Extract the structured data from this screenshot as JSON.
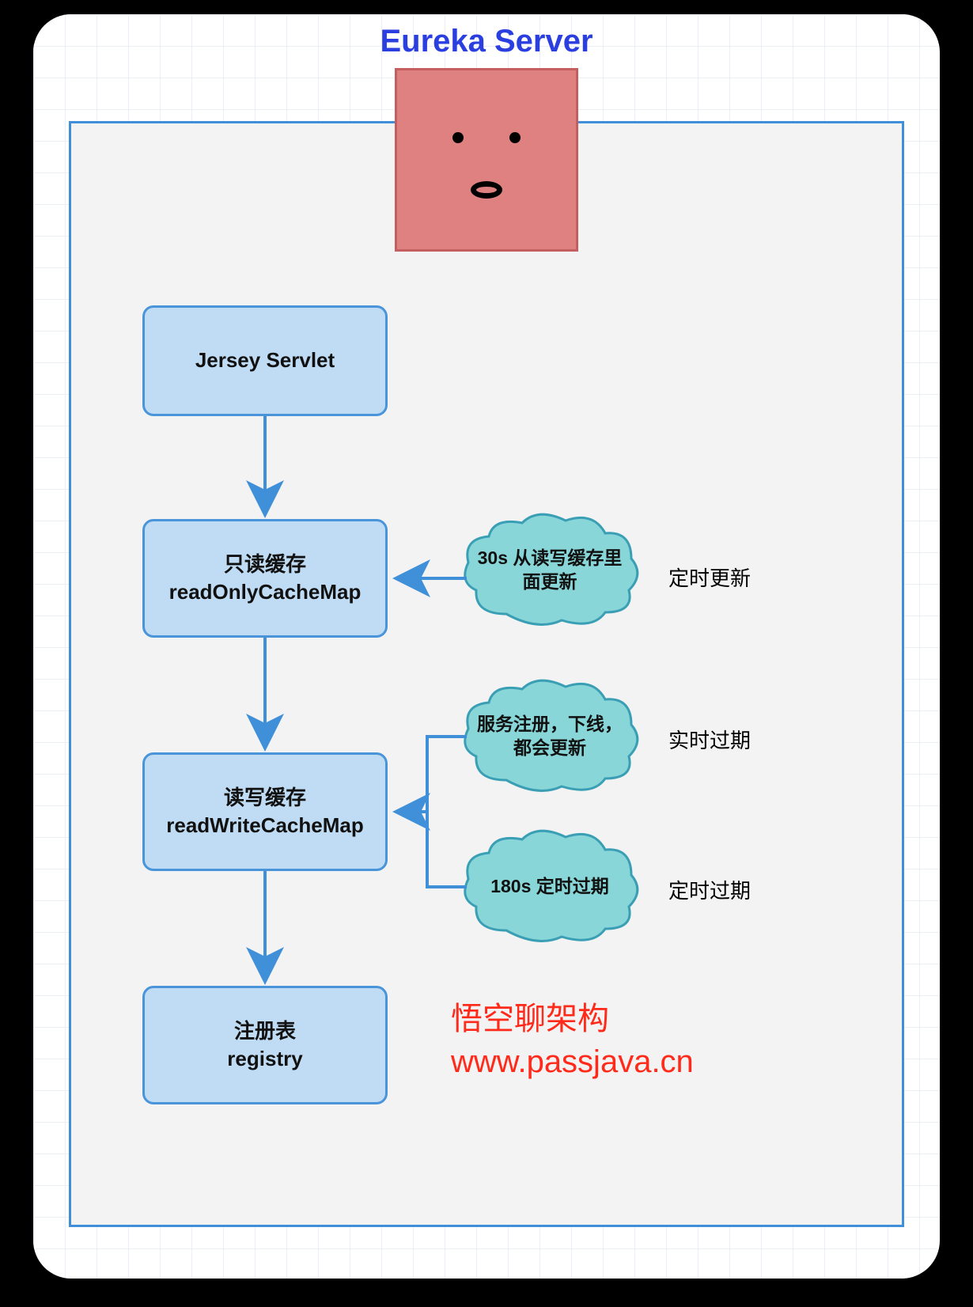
{
  "title": "Eureka Server",
  "nodes": {
    "jersey": {
      "label": "Jersey Servlet"
    },
    "readonly": {
      "line1": "只读缓存",
      "line2": "readOnlyCacheMap"
    },
    "readwrite": {
      "line1": "读写缓存",
      "line2": "readWriteCacheMap"
    },
    "registry": {
      "line1": "注册表",
      "line2": "registry"
    }
  },
  "clouds": {
    "c1": {
      "text": "30s 从读写缓存里面更新"
    },
    "c2": {
      "text": "服务注册，下线，都会更新"
    },
    "c3": {
      "text": "180s 定时过期"
    }
  },
  "side_labels": {
    "s1": "定时更新",
    "s2": "实时过期",
    "s3": "定时过期"
  },
  "watermark": {
    "line1": "悟空聊架构",
    "line2": "www.passjava.cn"
  },
  "colors": {
    "title": "#2b3fe0",
    "node_fill": "#bfdcf4",
    "node_border": "#4a95d9",
    "cloud_fill": "#89d6d8",
    "cloud_border": "#3a9fb5",
    "face_fill": "#e08181",
    "watermark": "#ff2a1a",
    "pane_border": "#3f8fd9"
  }
}
